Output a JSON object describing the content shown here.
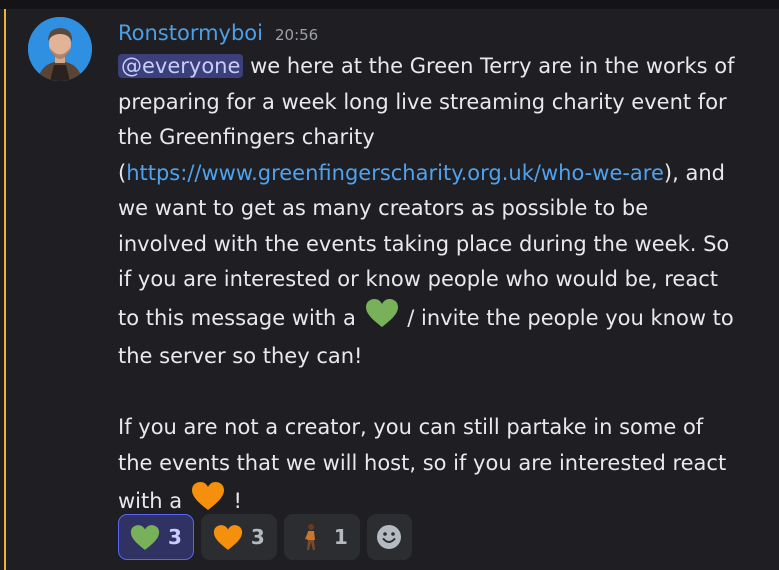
{
  "message": {
    "username": "Ronstormyboi",
    "timestamp": "20:56",
    "mention": "@everyone",
    "text_part1": " we here at the Green Terry are in the works of preparing for a week long live streaming charity event for the Greenfingers charity (",
    "link": "https://www.greenfingerscharity.org.uk/who-we-are",
    "text_part2": "), and we want to get as many creators as possible to be involved with the events taking place during the week. So if you are interested or know people who would be, react to this message with a ",
    "text_part3": " / invite the people you know to the server so they can!",
    "text_part4": "If you are not a creator, you can still partake in some of the events that we will host, so if you are interested react with a ",
    "text_part5": " !"
  },
  "reactions": [
    {
      "icon": "green-heart-icon",
      "count": "3",
      "color": "#78b159",
      "selected": true
    },
    {
      "icon": "orange-heart-icon",
      "count": "3",
      "color": "#f4900c",
      "selected": false
    },
    {
      "icon": "person-walking-icon",
      "count": "1",
      "selected": false
    }
  ],
  "add_reaction_icon": "smiley-face-icon",
  "colors": {
    "background": "#1f1f23",
    "highlight": "#f0b232",
    "username": "#4aa0e6",
    "link": "#4ea2ef",
    "mention_bg": "#3b3f7a",
    "reaction_selected_border": "#5865f2"
  }
}
